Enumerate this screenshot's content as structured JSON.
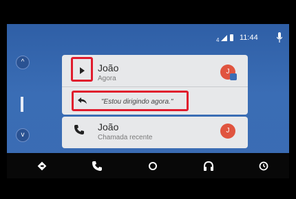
{
  "status_bar": {
    "signal_indicator": "4",
    "time": "11:44"
  },
  "side_panel": {
    "up_arrow": "^",
    "down_arrow": "v"
  },
  "notification_card": {
    "title": "João",
    "subtitle": "Agora",
    "avatar_initial": "J",
    "reply_text": "\"Estou dirigindo agora.\""
  },
  "call_card": {
    "title": "João",
    "subtitle": "Chamada recente",
    "avatar_initial": "J"
  },
  "colors": {
    "background": "#3a6db5",
    "card": "#e7e8ea",
    "highlight": "#e01b2d",
    "avatar": "#e0543f",
    "nav_bar": "#080808"
  },
  "nav_icons": [
    "navigation-icon",
    "phone-icon",
    "home-icon",
    "headphones-icon",
    "recents-icon"
  ]
}
